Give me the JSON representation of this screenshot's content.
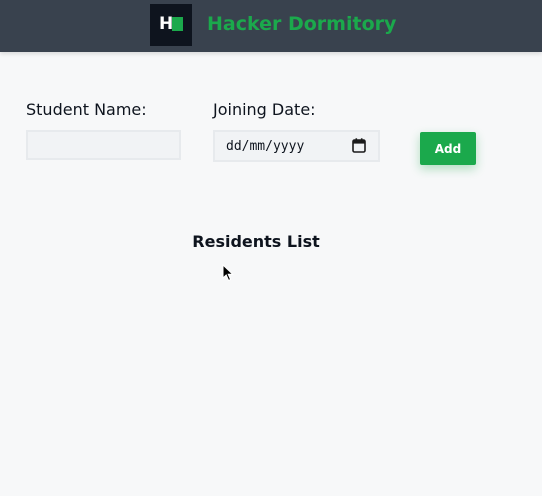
{
  "header": {
    "logo_letter": "H",
    "title": "Hacker Dormitory"
  },
  "form": {
    "student_name_label": "Student Name:",
    "student_name_value": "",
    "joining_date_label": "Joining Date:",
    "joining_date_placeholder": "dd/mm/yyyy",
    "add_label": "Add"
  },
  "residents": {
    "title": "Residents List",
    "items": []
  },
  "colors": {
    "header_bg": "#39424e",
    "accent_green": "#1ba94c",
    "logo_bg": "#0e141e",
    "page_bg": "#f7f8f9"
  },
  "icons": {
    "logo": "hackerrank-logo-icon",
    "calendar": "calendar-icon",
    "cursor": "mouse-pointer-icon"
  }
}
